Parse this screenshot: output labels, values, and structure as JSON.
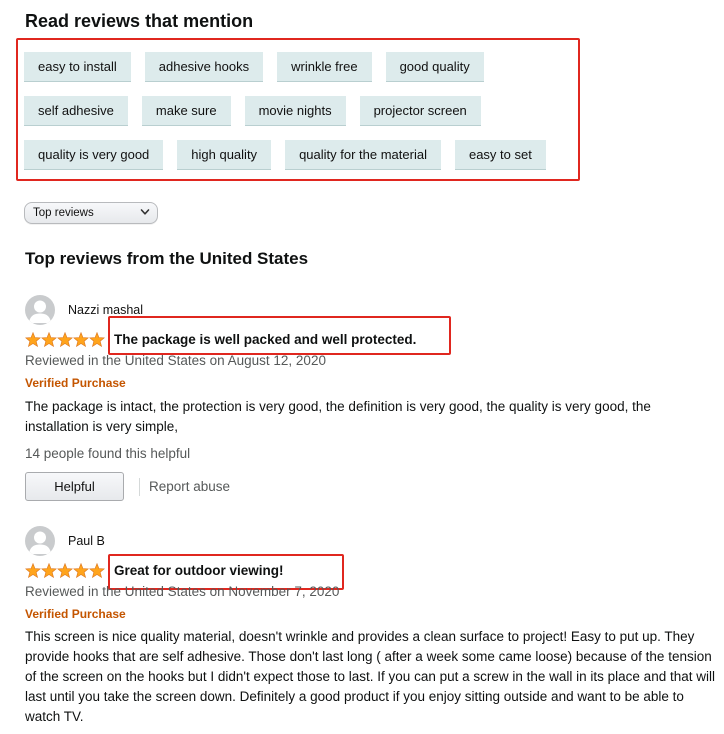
{
  "mentions": {
    "title": "Read reviews that mention",
    "rows": [
      [
        "easy to install",
        "adhesive hooks",
        "wrinkle free",
        "good quality"
      ],
      [
        "self adhesive",
        "make sure",
        "movie nights",
        "projector screen"
      ],
      [
        "quality is very good",
        "high quality",
        "quality for the material",
        "easy to set"
      ]
    ]
  },
  "sort": {
    "selected": "Top reviews"
  },
  "reviews_section": {
    "title": "Top reviews from the United States"
  },
  "reviews": [
    {
      "name": "Nazzi mashal",
      "rating": 5,
      "title": "The package is well packed and well protected.",
      "date_line": "Reviewed in the United States on August 12, 2020",
      "verified": "Verified Purchase",
      "body": "The package is intact, the protection is very good, the definition is very good, the quality is very good, the installation is very simple,",
      "helpful_count": "14 people found this helpful",
      "helpful_button": "Helpful",
      "report": "Report abuse"
    },
    {
      "name": "Paul B",
      "rating": 5,
      "title": "Great for outdoor viewing!",
      "date_line": "Reviewed in the United States on November 7, 2020",
      "verified": "Verified Purchase",
      "body": "This screen is nice quality material, doesn't wrinkle and provides a clean surface to project! Easy to put up. They provide hooks that are self adhesive. Those don't last long ( after a week some came loose) because of the tension of the screen on the hooks but I didn't expect those to last. If you can put a screw in the wall in its place and that will last until you take the screen down. Definitely a good product if you enjoy sitting outside and want to be able to watch TV."
    }
  ],
  "colors": {
    "highlight_border": "#e0271f",
    "chip_bg": "#ddebec",
    "star": "#ffa41c",
    "verified": "#c45500"
  }
}
